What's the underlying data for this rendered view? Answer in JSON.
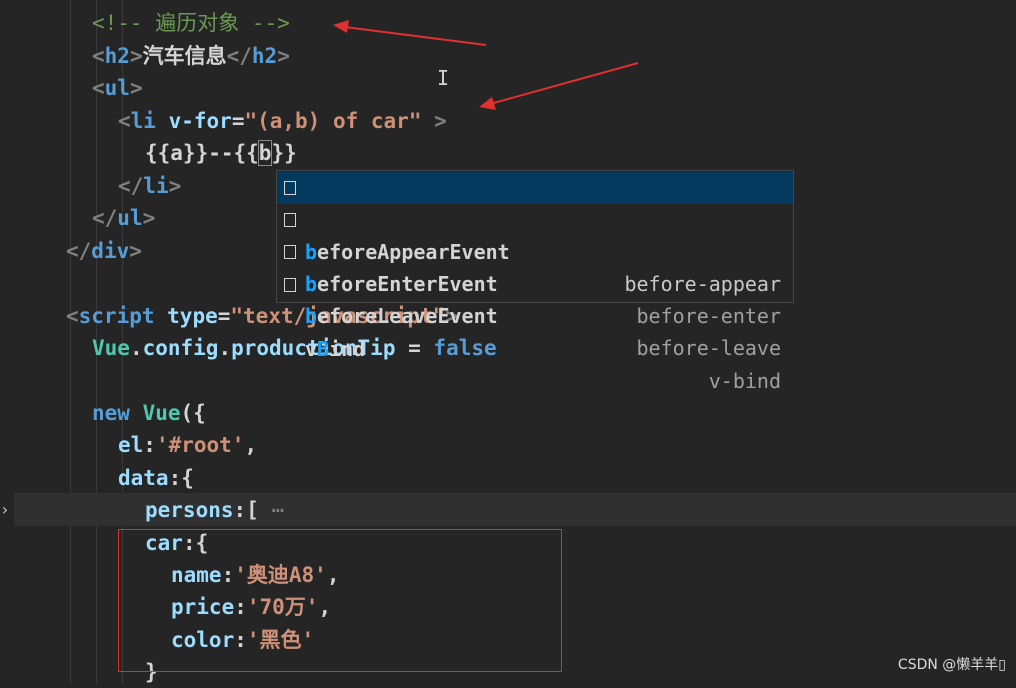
{
  "code": {
    "l1": {
      "open": "<!--",
      "text": " 遍历对象 ",
      "close": "-->"
    },
    "l2": {
      "lt": "<",
      "tag": "h2",
      "gt": ">",
      "text": "汽车信息",
      "lt2": "</",
      "tag2": "h2",
      "gt2": ">"
    },
    "l3": {
      "lt": "<",
      "tag": "ul",
      "gt": ">"
    },
    "l4": {
      "lt": "<",
      "tag": "li",
      "attr": " v-for",
      "eq": "=",
      "val": "\"(a,b) of car\"",
      "gt": " >"
    },
    "l5": {
      "text1": "{{a}}--{{",
      "text2": "b",
      "text3": "}}"
    },
    "l6": {
      "lt": "</",
      "tag": "li",
      "gt": ">"
    },
    "l7": {
      "lt": "</",
      "tag": "ul",
      "gt": ">"
    },
    "l8": {
      "lt": "</",
      "tag": "div",
      "gt": ">"
    },
    "l9": {
      "lt": "<",
      "tag": "script",
      "attr": " type",
      "eq": "=",
      "val": "\"text/javascript\"",
      "gt": ">"
    },
    "l10": {
      "obj": "Vue",
      "dot1": ".",
      "p1": "config",
      "dot2": ".",
      "p2": "productionTip",
      "eq": " = ",
      "val": "false"
    },
    "l11": {
      "kw": "new",
      "cls": " Vue",
      "rest": "({"
    },
    "l12": {
      "key": "el",
      "colon": ":",
      "val": "'#root'",
      "comma": ","
    },
    "l13": {
      "key": "data",
      "rest": ":{"
    },
    "l14": {
      "key": "persons",
      "rest": ":[",
      "ellipsis": " ⋯"
    },
    "l15": {
      "key": "car",
      "rest": ":{"
    },
    "l16": {
      "key": "name",
      "colon": ":",
      "val": "'奥迪A8'",
      "comma": ","
    },
    "l17": {
      "key": "price",
      "colon": ":",
      "val": "'70万'",
      "comma": ","
    },
    "l18": {
      "key": "color",
      "colon": ":",
      "val": "'黑色'"
    },
    "l19": {
      "text": "}"
    }
  },
  "suggestions": [
    {
      "match": "b",
      "label": "eforeAppearEvent",
      "detail": "before-appear"
    },
    {
      "match": "b",
      "label": "eforeEnterEvent",
      "detail": "before-enter"
    },
    {
      "match": "b",
      "label": "eforeLeaveEvent",
      "detail": "before-leave"
    },
    {
      "pre": "v",
      "match": "B",
      "label": "ind",
      "detail": "v-bind"
    }
  ],
  "watermark": "CSDN @懒羊羊▯",
  "colors": {
    "arrow": "#e0312e",
    "box": "#d9302e",
    "selection": "#04395e"
  }
}
